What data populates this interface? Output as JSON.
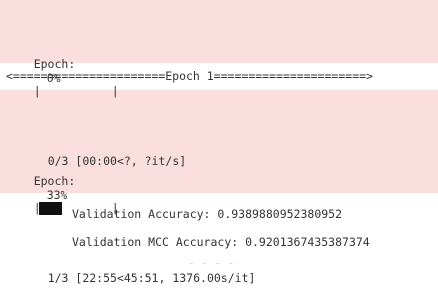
{
  "progress_bars": [
    {
      "label": "Epoch:",
      "percent_text": "0%",
      "left_pipe": "|",
      "right_pipe": "|",
      "fraction": 0.0,
      "stats": "0/3 [00:00<?, ?it/s]"
    },
    {
      "label": "Epoch:",
      "percent_text": "33%",
      "left_pipe": "|",
      "right_pipe": "|",
      "fraction": 0.33,
      "stats": "1/3 [22:55<45:51, 1376.00s/it]"
    }
  ],
  "epoch_banner": "<======================Epoch 1======================>",
  "validation": {
    "accuracy_line": "Validation Accuracy: 0.9389880952380952",
    "mcc_line": "Validation MCC Accuracy: 0.9201367435387374",
    "cut_line": "- - - -"
  },
  "colors": {
    "stderr_background": "#fbdede",
    "bar_fill": "#111111"
  }
}
